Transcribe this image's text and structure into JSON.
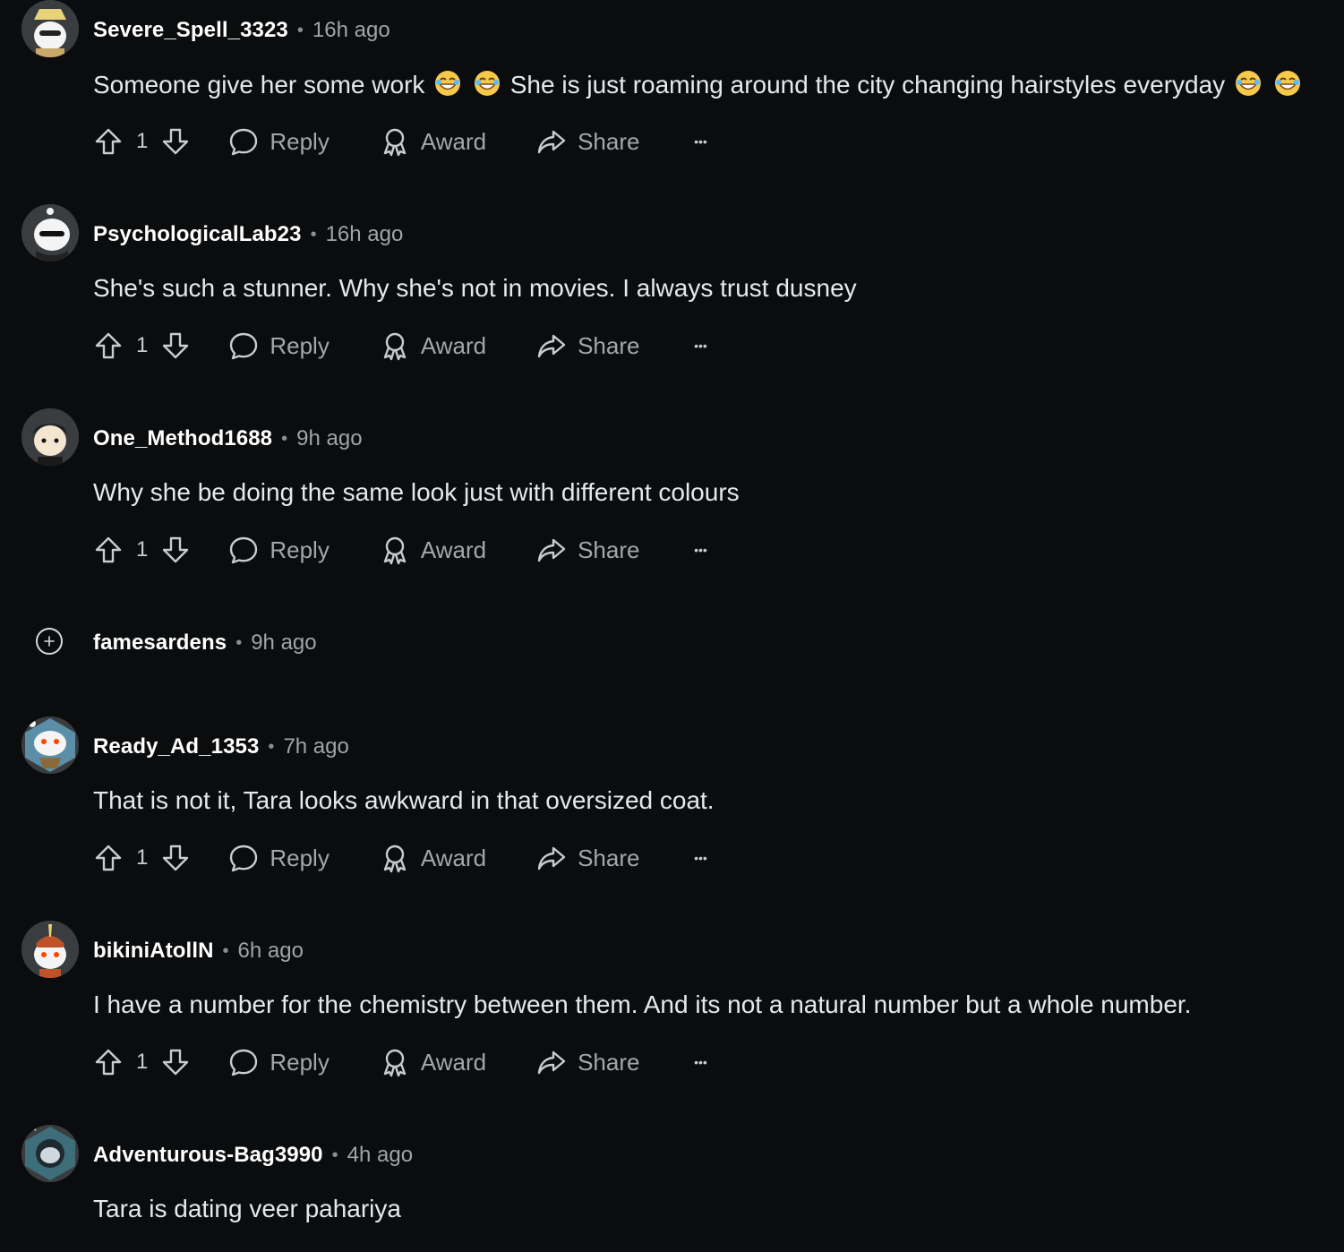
{
  "labels": {
    "reply": "Reply",
    "award": "Award",
    "share": "Share",
    "more": "•••",
    "sep": "•"
  },
  "comments": [
    {
      "username": "Severe_Spell_3323",
      "time": "16h ago",
      "text_a": "Someone give her some work",
      "text_b": "She is just roaming around the city changing hairstyles everyday",
      "votes": "1"
    },
    {
      "username": "PsychologicalLab23",
      "time": "16h ago",
      "text": "She's such a stunner. Why she's not in movies. I always trust dusney",
      "votes": "1"
    },
    {
      "username": "One_Method1688",
      "time": "9h ago",
      "text": "Why she be doing the same look just with different colours",
      "votes": "1"
    },
    {
      "username": "famesardens",
      "time": "9h ago",
      "collapsed": true
    },
    {
      "username": "Ready_Ad_1353",
      "time": "7h ago",
      "text": "That is not it, Tara looks awkward in that oversized coat.",
      "votes": "1"
    },
    {
      "username": "bikiniAtollN",
      "time": "6h ago",
      "text": "I have a number for the chemistry between them. And its not a natural number but a whole number.",
      "votes": "1"
    },
    {
      "username": "Adventurous-Bag3990",
      "time": "4h ago",
      "text": "Tara is dating veer pahariya"
    }
  ]
}
